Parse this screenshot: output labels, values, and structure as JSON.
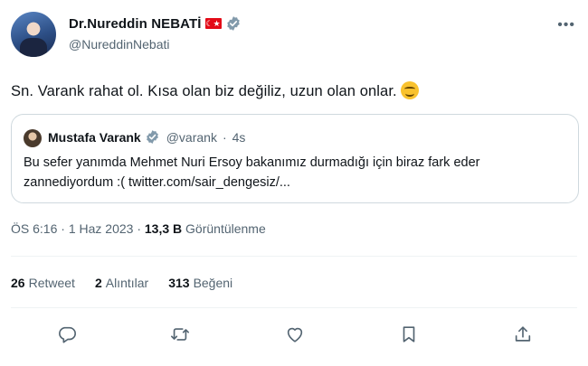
{
  "author": {
    "display_name": "Dr.Nureddin NEBATİ",
    "handle": "@NureddinNebati",
    "flag_symbol": "☾★"
  },
  "tweet": {
    "text": "Sn. Varank rahat ol. Kısa olan biz değiliz, uzun olan onlar."
  },
  "quote": {
    "name": "Mustafa Varank",
    "handle": "@varank",
    "separator": "·",
    "time": "4s",
    "text": "Bu sefer yanımda Mehmet Nuri Ersoy bakanımız durmadığı için biraz fark eder zannediyordum :( twitter.com/sair_dengesiz/..."
  },
  "meta": {
    "time": "ÖS 6:16",
    "sep1": "·",
    "date": "1 Haz 2023",
    "sep2": "·",
    "views_count": "13,3 B",
    "views_label": "Görüntülenme"
  },
  "stats": {
    "retweets_count": "26",
    "retweets_label": "Retweet",
    "quotes_count": "2",
    "quotes_label": "Alıntılar",
    "likes_count": "313",
    "likes_label": "Beğeni"
  },
  "colors": {
    "verified": "#829aab",
    "secondary_text": "#536471",
    "border": "#cfd9de"
  },
  "icons": [
    "more-icon",
    "verified-badge-icon",
    "reply-icon",
    "retweet-icon",
    "like-icon",
    "bookmark-icon",
    "share-icon"
  ]
}
